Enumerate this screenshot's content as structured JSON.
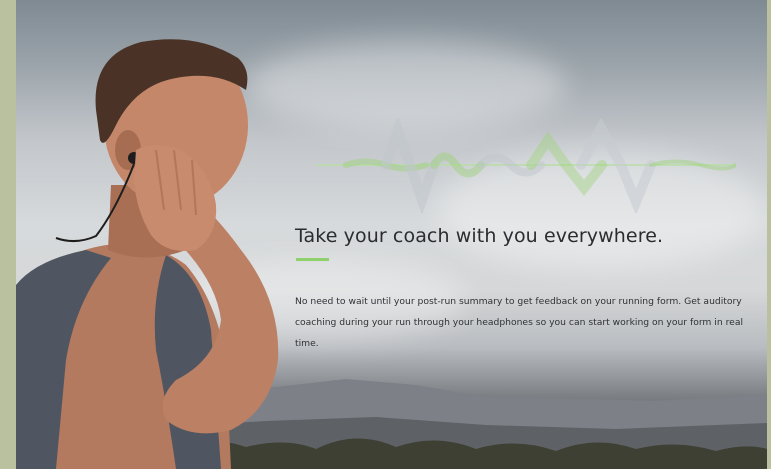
{
  "hero": {
    "headline": "Take your coach with you everywhere.",
    "body": "No need to wait until your post-run summary to get feedback on your running form. Get auditory coaching during your run through your headphones so you can start working on your form in real time.",
    "accent_color": "#8ed06a",
    "frame_color": "#b9c19f"
  },
  "imagery": {
    "photo_subject": "runner-with-earbud",
    "waveform_icon": "audio-waveform-icon"
  }
}
